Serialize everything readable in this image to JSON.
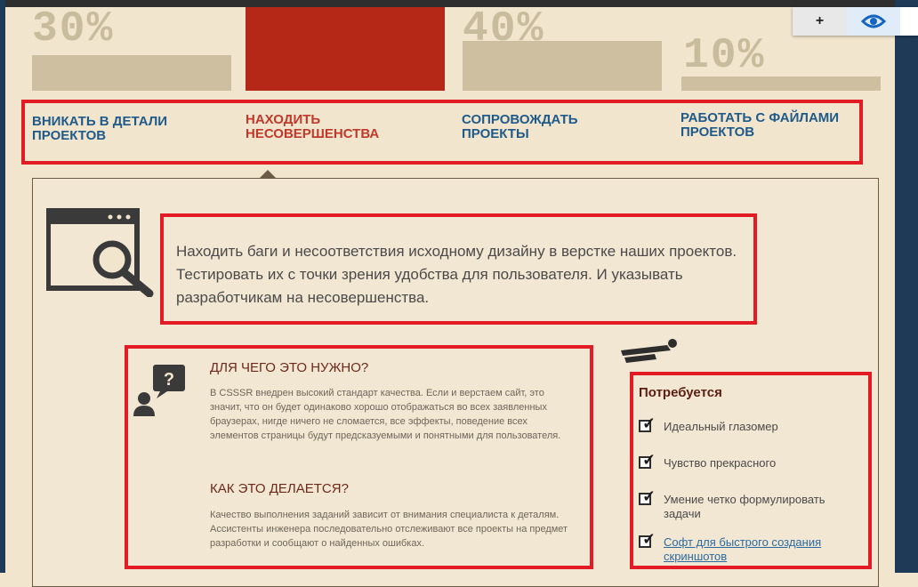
{
  "stats": [
    {
      "percent": "30%",
      "level": 0.3
    },
    {
      "percent": "",
      "level": 1.0
    },
    {
      "percent": "40%",
      "level": 0.4
    },
    {
      "percent": "10%",
      "level": 0.1
    }
  ],
  "nav": [
    {
      "label": "Вникать в детали проектов"
    },
    {
      "label": "Находить несовершенства"
    },
    {
      "label": "Сопровождать проекты"
    },
    {
      "label": "Работать с файлами проектов"
    }
  ],
  "intro": "Находить баги и несоответствия исходному дизайну в верстке наших проектов. Тестировать их с точки зрения удобства для пользователя. И указывать разработчикам на несовершенства.",
  "why": {
    "title": "Для чего это нужно?",
    "text": "В CSSSR внедрен высокий стандарт качества. Если и верстаем сайт, это значит, что он будет одинаково хорошо отображаться во всех заявленных браузерах, нигде ничего не сломается, все эффекты, поведение всех элементов страницы будут предсказуемыми и понятными для пользователя."
  },
  "how": {
    "title": "Как это делается?",
    "text": "Качество выполнения заданий зависит от внимания специалиста к деталям. Ассистенты инженера последовательно отслеживают все проекты на предмет разработки и сообщают о найденных ошибках."
  },
  "requirements": {
    "title": "Потребуется",
    "items": [
      {
        "label": "Идеальный глазомер",
        "link": false
      },
      {
        "label": "Чувство прекрасного",
        "link": false
      },
      {
        "label": "Умение четко формулировать задачи",
        "link": false
      },
      {
        "label": "Софт для быстрого создания скриншотов",
        "link": true
      }
    ]
  },
  "toolbar": {
    "plus_label": "+"
  },
  "colors": {
    "accent_red": "#e21b24",
    "link_blue": "#1f5a8a",
    "active_red": "#c0392b",
    "bar_red": "#b52818"
  }
}
